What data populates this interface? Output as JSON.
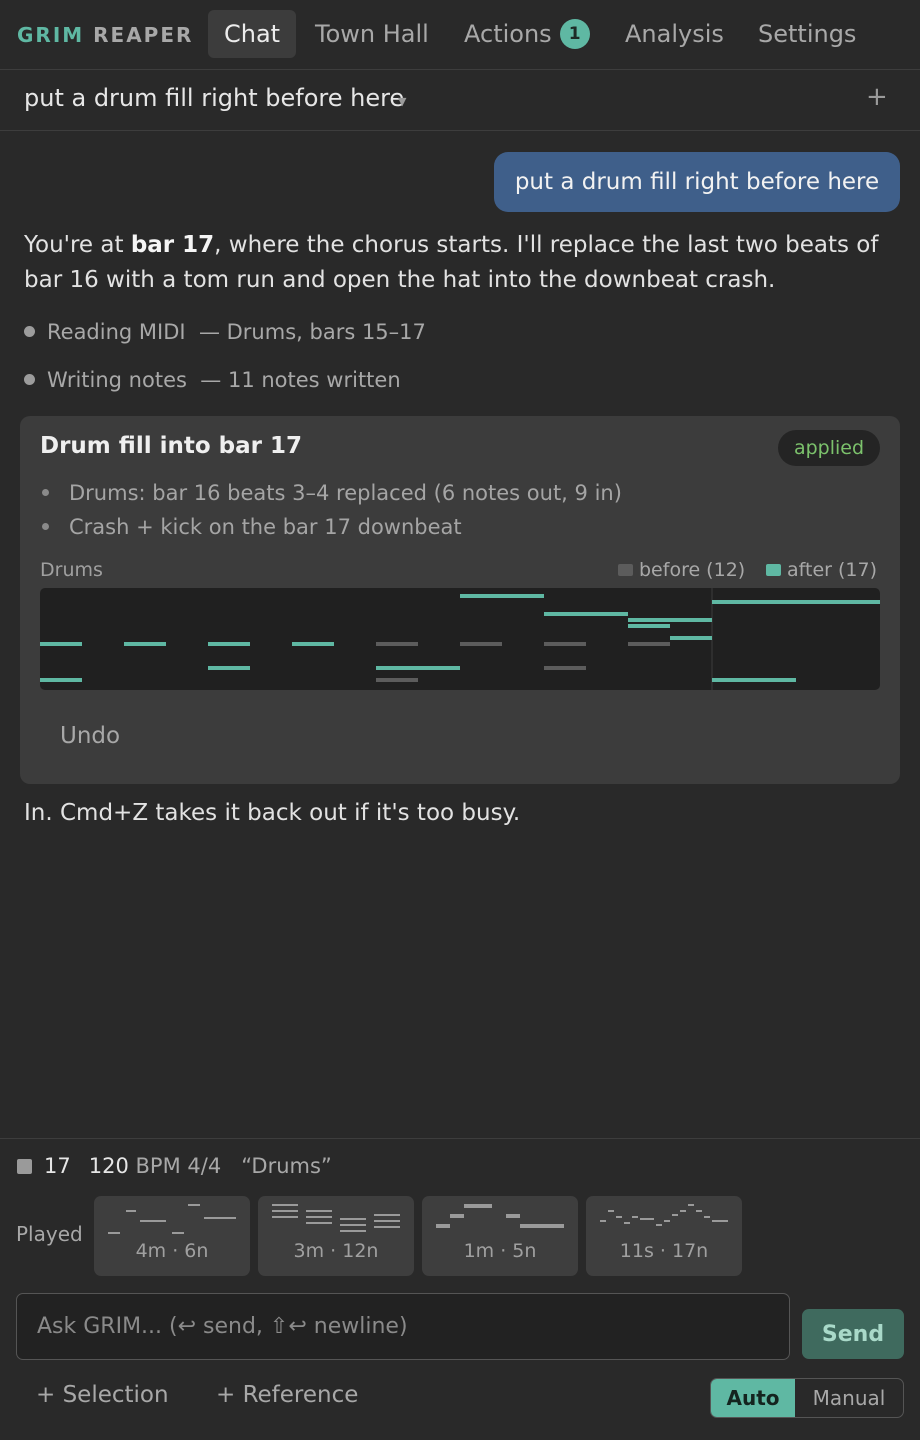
{
  "brand": {
    "part1": "GRIM",
    "part2": "REAPER"
  },
  "tabs": [
    {
      "label": "Chat",
      "active": true
    },
    {
      "label": "Town Hall"
    },
    {
      "label": "Actions",
      "badge": "1"
    },
    {
      "label": "Analysis"
    },
    {
      "label": "Settings"
    }
  ],
  "thread": {
    "title": "put a drum fill right before here",
    "add_icon": "plus-icon",
    "dropdown_icon": "chevron-down-icon"
  },
  "messages": {
    "user": "put a drum fill right before here",
    "assistant_pre": "You're at ",
    "assistant_bold": "bar 17",
    "assistant_post": ", where the chorus starts. I'll replace the last two beats of bar 16 with a tom run and open the hat into the downbeat crash.",
    "steps": [
      {
        "label": "Reading MIDI",
        "detail": "— Drums, bars 15–17"
      },
      {
        "label": "Writing notes",
        "detail": "— 11 notes written"
      }
    ],
    "closing": "In. Cmd+Z takes it back out if it's too busy."
  },
  "card": {
    "title": "Drum fill into bar 17",
    "status": "applied",
    "bullets": [
      "Drums: bar 16 beats 3–4 replaced (6 notes out, 9 in)",
      "Crash + kick on the bar 17 downbeat"
    ],
    "track_label": "Drums",
    "legend_before": "before (12)",
    "legend_after": "after (17)",
    "undo_label": "Undo",
    "colors": {
      "after": "#5fb8a3",
      "before": "#5c5c5c"
    }
  },
  "status": {
    "bar": "17",
    "bpm": "120",
    "bpm_unit": "BPM 4/4",
    "track": "“Drums”"
  },
  "played": {
    "label": "Played",
    "items": [
      {
        "meta": "4m · 6n"
      },
      {
        "meta": "3m · 12n"
      },
      {
        "meta": "1m · 5n"
      },
      {
        "meta": "11s · 17n"
      }
    ]
  },
  "input": {
    "placeholder": "Ask GRIM... (↩ send, ⇧↩ newline)",
    "value": ""
  },
  "send_label": "Send",
  "links": {
    "selection": "+ Selection",
    "reference": "+ Reference"
  },
  "mode": {
    "auto": "Auto",
    "manual": "Manual",
    "selected": "Auto"
  },
  "accent": "#5fb8a3"
}
